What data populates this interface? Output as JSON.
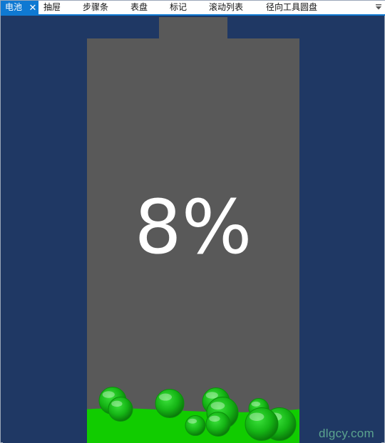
{
  "tabs": [
    {
      "label": "电池",
      "active": true
    },
    {
      "label": "抽屉",
      "active": false
    },
    {
      "label": "步骤条",
      "active": false
    },
    {
      "label": "表盘",
      "active": false
    },
    {
      "label": "标记",
      "active": false
    },
    {
      "label": "滚动列表",
      "active": false
    },
    {
      "label": "径向工具圆盘",
      "active": false
    }
  ],
  "icons": {
    "close": "close-icon",
    "dropdown": "dropdown-arrow-icon"
  },
  "battery": {
    "level_percent": 8,
    "label": "8%"
  },
  "watermark": "dlgcy.com",
  "colors": {
    "accent": "#0f79d2",
    "background": "#1f3864",
    "battery_body": "#595959",
    "liquid": "#11cc00",
    "bubble": "#14b814",
    "label": "#ffffff",
    "watermark": "#5ba38e"
  }
}
